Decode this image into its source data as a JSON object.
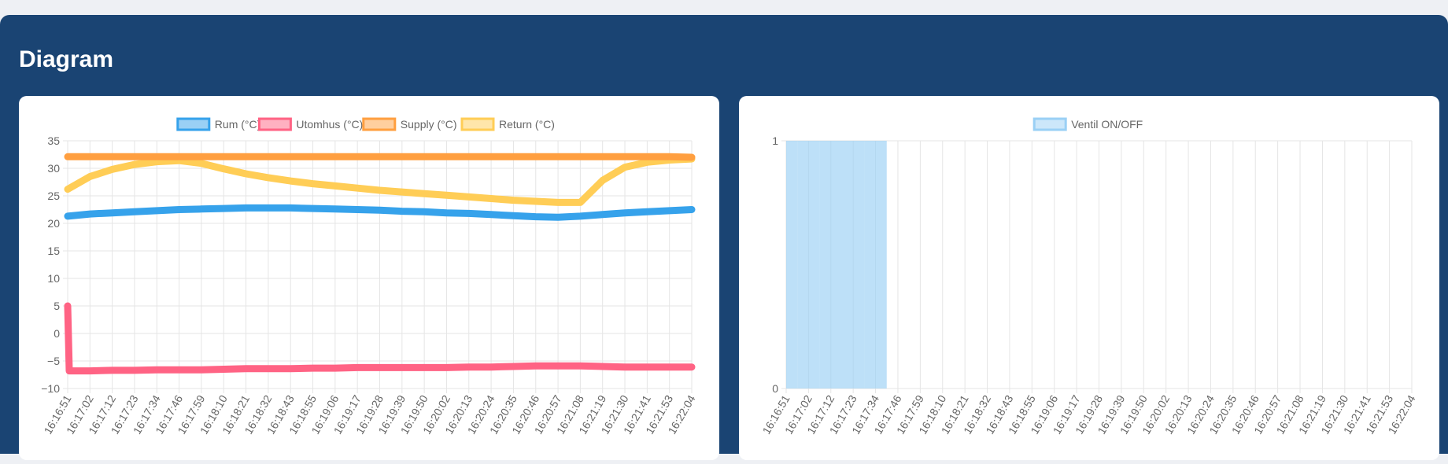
{
  "page": {
    "title": "Diagram"
  },
  "colors": {
    "rum": "#36a2eb",
    "utomhus": "#ff6384",
    "supply": "#ff9f40",
    "return": "#ffcd56",
    "ventil": "#9ad0f5",
    "grid": "#e5e5e5",
    "tick": "#666666"
  },
  "chart_data": [
    {
      "type": "line",
      "x_labels": [
        "16:16:51",
        "16:17:02",
        "16:17:12",
        "16:17:23",
        "16:17:34",
        "16:17:46",
        "16:17:59",
        "16:18:10",
        "16:18:21",
        "16:18:32",
        "16:18:43",
        "16:18:55",
        "16:19:06",
        "16:19:17",
        "16:19:28",
        "16:19:39",
        "16:19:50",
        "16:20:02",
        "16:20:13",
        "16:20:24",
        "16:20:35",
        "16:20:46",
        "16:20:57",
        "16:21:08",
        "16:21:19",
        "16:21:30",
        "16:21:41",
        "16:21:53",
        "16:22:04"
      ],
      "ylim": [
        -10,
        35
      ],
      "y_ticks": [
        "35",
        "30",
        "25",
        "20",
        "15",
        "10",
        "5",
        "0",
        "−5",
        "−10"
      ],
      "legend_position": "top-center",
      "grid": true,
      "series": [
        {
          "name": "Rum (°C)",
          "color": "#36a2eb",
          "values": [
            21.3,
            21.7,
            21.9,
            22.1,
            22.3,
            22.5,
            22.6,
            22.7,
            22.8,
            22.8,
            22.8,
            22.7,
            22.6,
            22.5,
            22.4,
            22.2,
            22.1,
            21.9,
            21.8,
            21.6,
            21.4,
            21.2,
            21.1,
            21.3,
            21.6,
            21.9,
            22.1,
            22.3,
            22.5
          ]
        },
        {
          "name": "Utomhus (°C)",
          "color": "#ff6384",
          "values": [
            -6.8,
            -6.8,
            -6.7,
            -6.7,
            -6.6,
            -6.6,
            -6.6,
            -6.5,
            -6.4,
            -6.4,
            -6.4,
            -6.3,
            -6.3,
            -6.2,
            -6.2,
            -6.2,
            -6.2,
            -6.2,
            -6.1,
            -6.1,
            -6.0,
            -5.9,
            -5.9,
            -5.9,
            -6.0,
            -6.1,
            -6.1,
            -6.1,
            -6.1
          ],
          "first_point": 5
        },
        {
          "name": "Supply (°C)",
          "color": "#ff9f40",
          "values": [
            32.1,
            32.1,
            32.1,
            32.1,
            32.1,
            32.1,
            32.1,
            32.1,
            32.1,
            32.1,
            32.1,
            32.1,
            32.1,
            32.1,
            32.1,
            32.1,
            32.1,
            32.1,
            32.1,
            32.1,
            32.1,
            32.1,
            32.1,
            32.1,
            32.1,
            32.1,
            32.1,
            32.1,
            32.0
          ]
        },
        {
          "name": "Return (°C)",
          "color": "#ffcd56",
          "values": [
            26.2,
            28.5,
            29.8,
            30.7,
            31.2,
            31.4,
            30.9,
            29.9,
            29.0,
            28.3,
            27.7,
            27.2,
            26.8,
            26.4,
            26.0,
            25.7,
            25.4,
            25.1,
            24.8,
            24.5,
            24.2,
            24.0,
            23.8,
            23.8,
            27.8,
            30.2,
            31.1,
            31.5,
            31.7
          ]
        }
      ]
    },
    {
      "type": "bar",
      "x_labels": [
        "16:16:51",
        "16:17:02",
        "16:17:12",
        "16:17:23",
        "16:17:34",
        "16:17:46",
        "16:17:59",
        "16:18:10",
        "16:18:21",
        "16:18:32",
        "16:18:43",
        "16:18:55",
        "16:19:06",
        "16:19:17",
        "16:19:28",
        "16:19:39",
        "16:19:50",
        "16:20:02",
        "16:20:13",
        "16:20:24",
        "16:20:35",
        "16:20:46",
        "16:20:57",
        "16:21:08",
        "16:21:19",
        "16:21:30",
        "16:21:41",
        "16:21:53",
        "16:22:04"
      ],
      "ylim": [
        0,
        1
      ],
      "y_ticks": [
        "1",
        "0"
      ],
      "legend_position": "top-center",
      "grid": true,
      "series": [
        {
          "name": "Ventil ON/OFF",
          "color": "#9ad0f5",
          "values": [
            1,
            1,
            1,
            1,
            1,
            0,
            0,
            0,
            0,
            0,
            0,
            0,
            0,
            0,
            0,
            0,
            0,
            0,
            0,
            0,
            0,
            0,
            0,
            0,
            0,
            0,
            0,
            0,
            0
          ]
        }
      ]
    }
  ]
}
